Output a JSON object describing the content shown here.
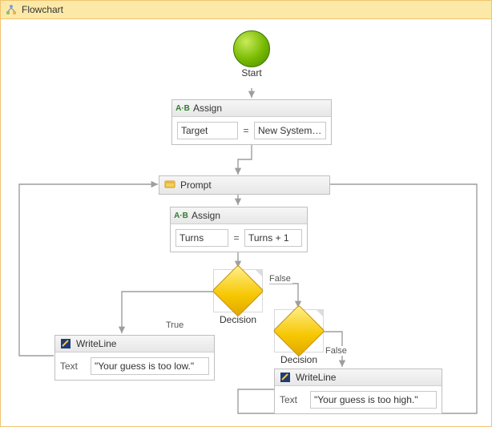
{
  "title": "Flowchart",
  "start": {
    "label": "Start"
  },
  "assign1": {
    "header": "Assign",
    "left": "Target",
    "eq": "=",
    "right": "New System.Randc"
  },
  "prompt": {
    "header": "Prompt"
  },
  "assign2": {
    "header": "Assign",
    "left": "Turns",
    "eq": "=",
    "right": "Turns + 1"
  },
  "decision1": {
    "label": "Decision",
    "trueLabel": "True",
    "falseLabel": "False"
  },
  "decision2": {
    "label": "Decision",
    "falseLabel": "False"
  },
  "writeLow": {
    "header": "WriteLine",
    "textLabel": "Text",
    "text": "\"Your guess is too low.\""
  },
  "writeHigh": {
    "header": "WriteLine",
    "textLabel": "Text",
    "text": "\"Your guess is too high.\""
  }
}
